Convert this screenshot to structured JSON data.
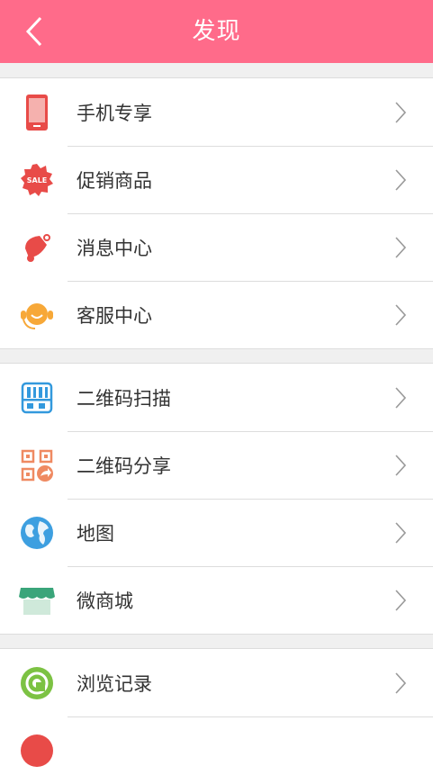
{
  "header": {
    "title": "发现"
  },
  "groups": [
    {
      "items": [
        {
          "label": "手机专享",
          "icon": "mobile-icon"
        },
        {
          "label": "促销商品",
          "icon": "sale-badge-icon"
        },
        {
          "label": "消息中心",
          "icon": "bell-icon"
        },
        {
          "label": "客服中心",
          "icon": "headset-icon"
        }
      ]
    },
    {
      "items": [
        {
          "label": "二维码扫描",
          "icon": "qr-scan-icon"
        },
        {
          "label": "二维码分享",
          "icon": "qr-share-icon"
        },
        {
          "label": "地图",
          "icon": "globe-icon"
        },
        {
          "label": "微商城",
          "icon": "shop-awning-icon"
        }
      ]
    },
    {
      "items": [
        {
          "label": "浏览记录",
          "icon": "history-icon"
        }
      ]
    }
  ],
  "colors": {
    "accent": "#ff6b8a",
    "background": "#f0f0f0"
  }
}
